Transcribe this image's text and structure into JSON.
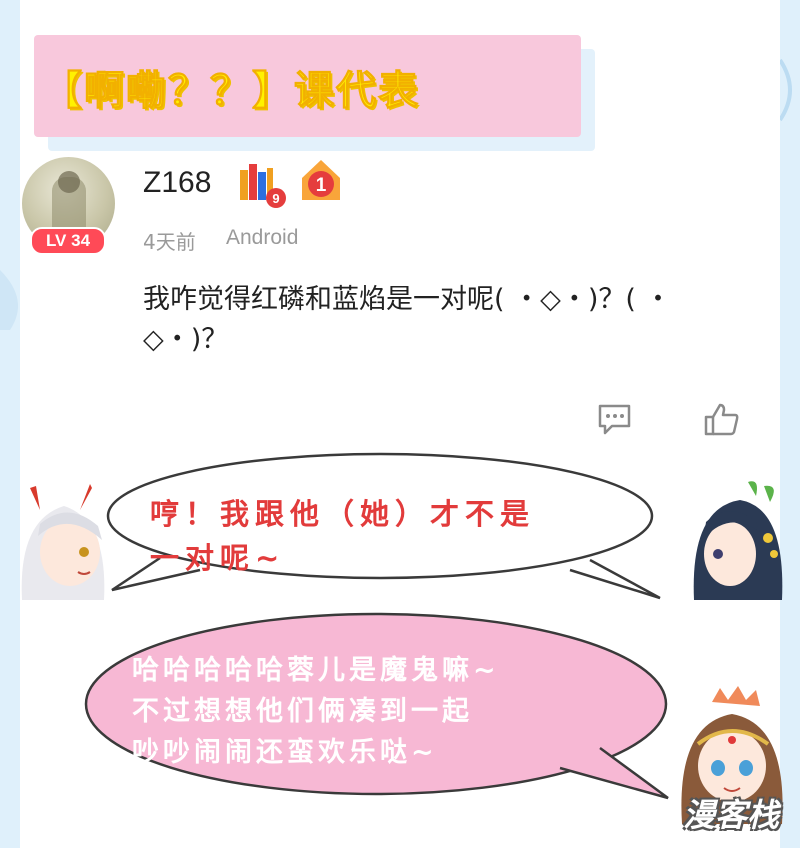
{
  "title": "【啊嘞？？】课代表",
  "post": {
    "username": "Z168",
    "level_prefix": "LV",
    "level": "34",
    "medal_count": "9",
    "rank_medal": "1",
    "time": "4天前",
    "device": "Android",
    "comment_line1": "我咋觉得红磷和蓝焰是一对呢( ・◇・)？( ・",
    "comment_line2": "◇・)？"
  },
  "bubble_top": {
    "line1": "哼！我跟他（她）才不是",
    "line2": "一对呢~",
    "color": "#e23b3b"
  },
  "bubble_bottom": {
    "line1": "哈哈哈哈哈蓉儿是魔鬼嘛~",
    "line2": "不过想想他们俩凑到一起",
    "line3": "吵吵闹闹还蛮欢乐哒~",
    "color": "#f7b8d4"
  },
  "icons": [
    "comment-icon",
    "like-icon",
    "bookshelf-medal-icon",
    "rank-medal-icon"
  ],
  "watermark": "漫客栈"
}
